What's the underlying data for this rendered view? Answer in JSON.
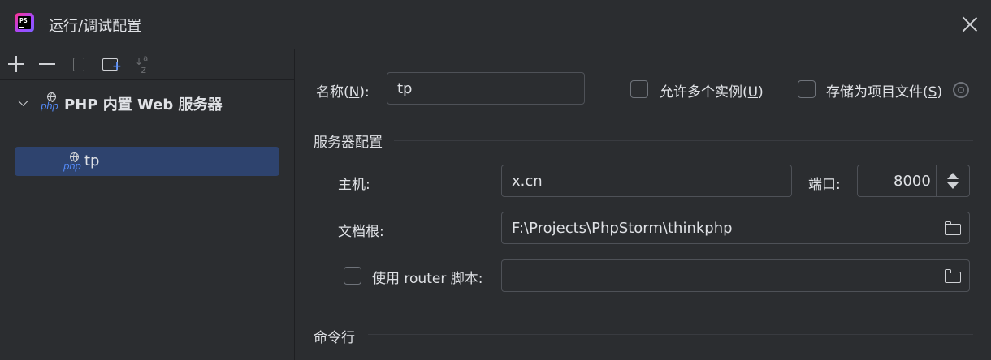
{
  "window": {
    "title": "运行/调试配置",
    "app_icon_text": "PS"
  },
  "tree": {
    "group_label": "PHP 内置 Web 服务器",
    "group_icon_text": "php",
    "item_label": "tp",
    "item_icon_text": "php"
  },
  "form": {
    "name_label_prefix": "名称(",
    "name_label_mnemonic": "N",
    "name_label_suffix": "):",
    "name_value": "tp",
    "allow_multi_prefix": "允许多个实例(",
    "allow_multi_mnemonic": "U",
    "allow_multi_suffix": ")",
    "store_prefix": "存储为项目文件(",
    "store_mnemonic": "S",
    "store_suffix": ")",
    "server_section": "服务器配置",
    "host_label": "主机:",
    "host_value": "x.cn",
    "port_label": "端口:",
    "port_value": "8000",
    "docroot_label": "文档根:",
    "docroot_value": "F:\\Projects\\PhpStorm\\thinkphp",
    "router_label": "使用 router 脚本:",
    "router_value": "",
    "cmdline_section": "命令行"
  },
  "colors": {
    "accent": "#548af7",
    "selection": "#2e436e",
    "background": "#2b2d30"
  }
}
